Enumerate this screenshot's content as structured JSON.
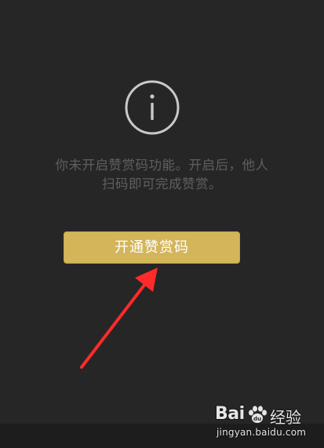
{
  "message": {
    "line1": "你未开启赞赏码功能。开启后，他人",
    "line2": "扫码即可完成赞赏。"
  },
  "button": {
    "label": "开通赞赏码"
  },
  "icons": {
    "info": "info-circle-icon",
    "arrow": "red-arrow-annotation"
  },
  "colors": {
    "background": "#262626",
    "button": "#d3b55a",
    "arrow": "#ff2a2a"
  },
  "watermark": {
    "logo_latin": "Bai",
    "logo_cn": "经验",
    "url": "jingyan.baidu.com"
  }
}
